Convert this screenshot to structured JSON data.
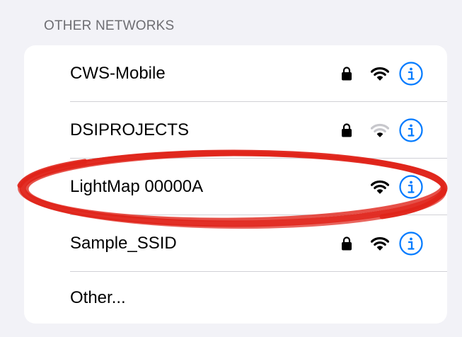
{
  "section_header": "OTHER NETWORKS",
  "accent_color": "#007aff",
  "annotation_color": "#e0241a",
  "networks": [
    {
      "name": "CWS-Mobile",
      "locked": true,
      "signal": "full",
      "info_icon": "info-circle-icon"
    },
    {
      "name": "DSIPROJECTS",
      "locked": true,
      "signal": "weak",
      "info_icon": "info-circle-icon"
    },
    {
      "name": "LightMap 00000A",
      "locked": false,
      "signal": "full",
      "info_icon": "info-circle-icon",
      "annotated": true
    },
    {
      "name": "Sample_SSID",
      "locked": true,
      "signal": "full",
      "info_icon": "info-circle-icon"
    }
  ],
  "other_label": "Other..."
}
